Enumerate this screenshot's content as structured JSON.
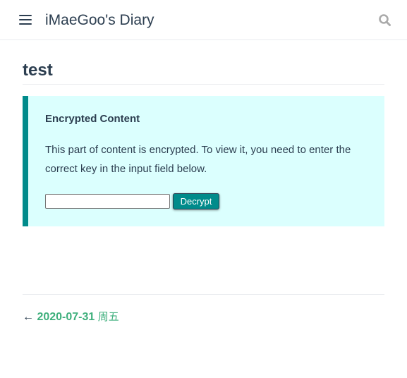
{
  "navbar": {
    "menu_icon": "hamburger-menu-icon",
    "site_name": "iMaeGoo's Diary",
    "search_icon": "search-icon"
  },
  "page": {
    "title": "test"
  },
  "encrypt": {
    "heading": "Encrypted Content",
    "description": "This part of content is encrypted. To view it, you need to enter the correct key in the input field below.",
    "input_value": "",
    "button_label": "Decrypt"
  },
  "page_nav": {
    "arrow": "←",
    "prev_date": "2020-07-31",
    "prev_weekday": "周五"
  },
  "colors": {
    "text": "#2c3e50",
    "accent_green": "#3eaf7c",
    "encrypt_bg": "#dbfffe",
    "encrypt_border": "#008b8b",
    "button_bg": "#008b8b"
  }
}
